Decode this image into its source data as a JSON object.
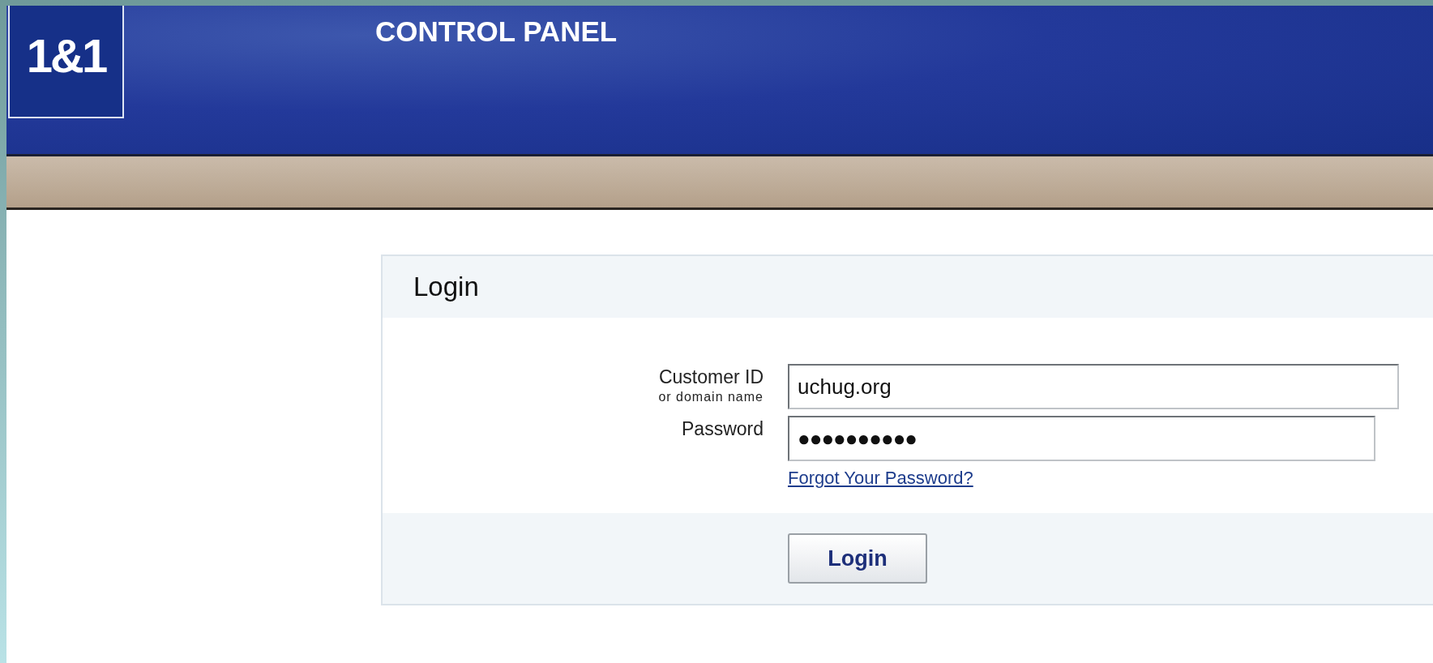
{
  "header": {
    "logo": "1&1",
    "title": "CONTROL PANEL"
  },
  "login": {
    "title": "Login",
    "fields": [
      {
        "kind": "text",
        "label": "Customer ID",
        "sublabel": "or domain name",
        "value": "uchug.org"
      },
      {
        "kind": "password",
        "label": "Password",
        "value": "●●●●●●●●●●"
      }
    ],
    "link": "Forgot Your Password?",
    "button": "Login"
  }
}
